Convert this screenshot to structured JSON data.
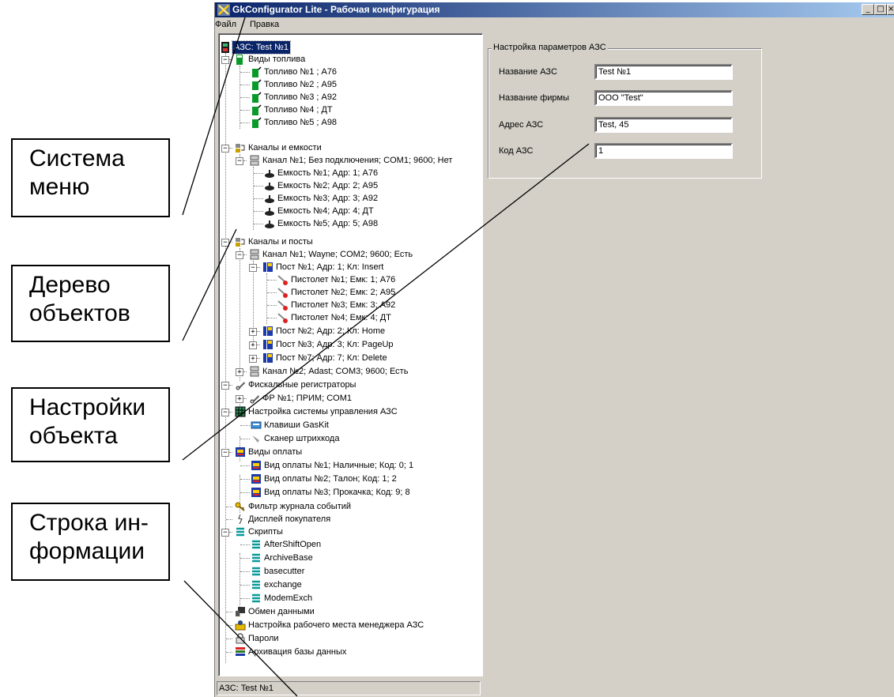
{
  "callouts": {
    "menu": [
      "Система",
      "меню"
    ],
    "tree": [
      "Дерево",
      "объектов"
    ],
    "settings": [
      "Настройки",
      "объекта"
    ],
    "info": [
      "Строка ин-",
      "формации"
    ]
  },
  "window": {
    "title": "GkConfigurator Lite - Рабочая конфигурация",
    "controls": [
      "_",
      "□",
      "×"
    ]
  },
  "menubar": {
    "file": "Файл",
    "edit": "Правка"
  },
  "tree": {
    "root": "АЗС: Test №1",
    "fuel_types": "Виды топлива",
    "fuels": [
      "Топливо №1 ; А76",
      "Топливо №2 ; А95",
      "Топливо №3 ; А92",
      "Топливо №4 ; ДТ",
      "Топливо №5 ; А98"
    ],
    "tanks_channels": "Каналы и емкости",
    "tank_channel": "Канал №1; Без подключения; COM1; 9600; Нет",
    "tanks": [
      "Емкость №1; Адр: 1; А76",
      "Емкость №2; Адр: 2; А95",
      "Емкость №3; Адр: 3; А92",
      "Емкость №4; Адр: 4; ДТ",
      "Емкость №5; Адр: 5; А98"
    ],
    "posts_channels": "Каналы и посты",
    "post_channel1": "Канал №1; Wayne; COM2; 9600; Есть",
    "post1": "Пост №1; Адр: 1; Кл: Insert",
    "pistols": [
      "Пистолет №1; Емк: 1; А76",
      "Пистолет №2; Емк: 2; А95",
      "Пистолет №3; Емк: 3; А92",
      "Пистолет №4; Емк: 4; ДТ"
    ],
    "post2": "Пост №2; Адр: 2; Кл: Home",
    "post3": "Пост №3; Адр: 3; Кл: PageUp",
    "post7": "Пост №7; Адр: 7; Кл: Delete",
    "post_channel2": "Канал №2; Adast; COM3; 9600; Есть",
    "fiscal": "Фискальные регистраторы",
    "fiscal_item": "ФР №1; ПРИМ; COM1",
    "control_setup": "Настройка системы управления АЗС",
    "gaskit": "Клавиши GasKit",
    "scanner": "Сканер штрихкода",
    "payment_types": "Виды оплаты",
    "payments": [
      "Вид оплаты №1; Наличные; Код: 0; 1",
      "Вид оплаты №2; Талон; Код: 1; 2",
      "Вид оплаты №3; Прокачка; Код: 9; 8"
    ],
    "event_filter": "Фильтр журнала событий",
    "customer_display": "Дисплей покупателя",
    "scripts": "Скрипты",
    "script_items": [
      "AfterShiftOpen",
      "ArchiveBase",
      "basecutter",
      "exchange",
      "ModemExch"
    ],
    "data_exchange": "Обмен данными",
    "manager_setup": "Настройка рабочего места менеджера АЗС",
    "passwords": "Пароли",
    "archiving": "Архивация базы данных"
  },
  "settings": {
    "group_title": "Настройка параметров АЗС",
    "fields": [
      {
        "label": "Название АЗС",
        "value": "Test №1"
      },
      {
        "label": "Название фирмы",
        "value": "ООО \"Test\""
      },
      {
        "label": "Адрес АЗС",
        "value": "Test, 45"
      },
      {
        "label": "Код АЗС",
        "value": "1"
      }
    ]
  },
  "status": {
    "text": "АЗС: Test №1"
  }
}
